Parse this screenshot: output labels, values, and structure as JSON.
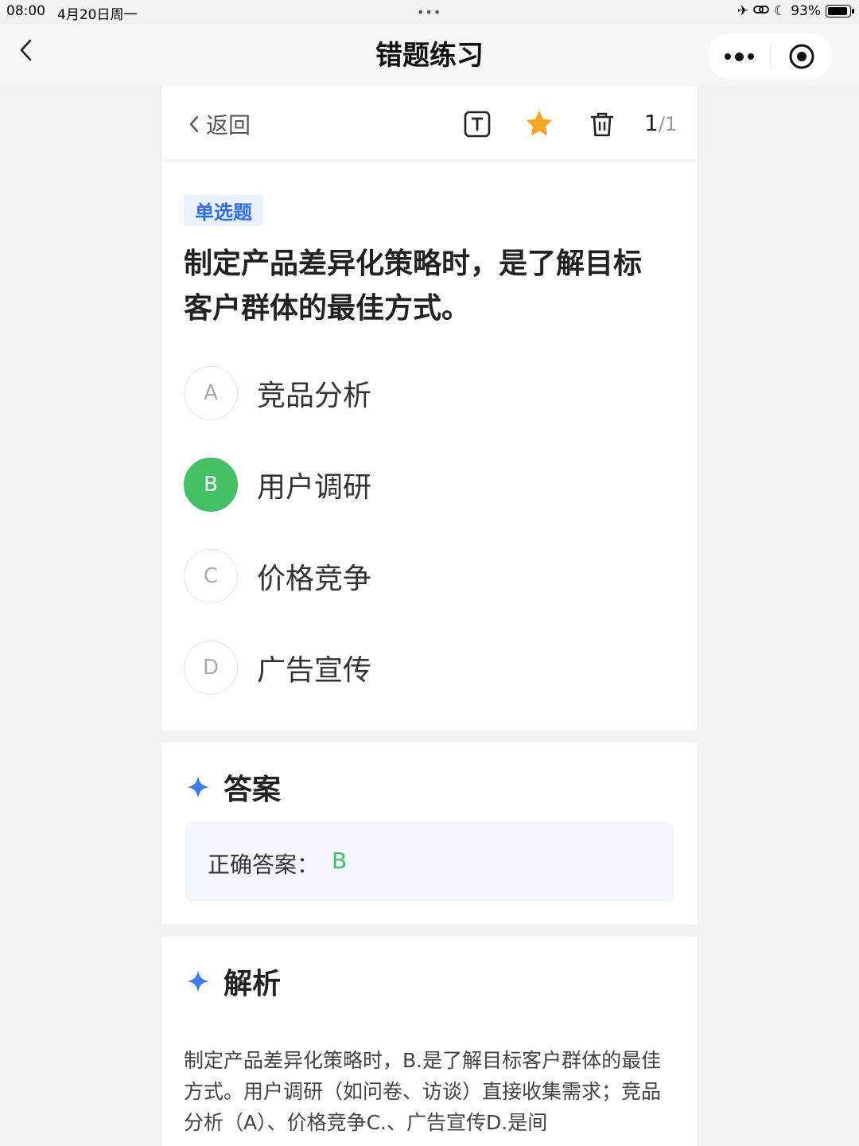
{
  "status_bar": {
    "time": "08:00",
    "date": "4月20日周一",
    "battery": "93%",
    "battery_level": 0.93
  },
  "nav": {
    "title": "错题练习"
  },
  "toolbar": {
    "back_label": "返回",
    "current": "1",
    "separator": "/",
    "total": "1",
    "icons": [
      "font-icon",
      "star-icon",
      "trash-icon"
    ],
    "star_color": "#f5a623"
  },
  "question": {
    "type_tag": "单选题",
    "text": "制定产品差异化策略时，是了解目标客户群体的最佳方式。",
    "options": [
      {
        "key": "A",
        "label": "竞品分析"
      },
      {
        "key": "B",
        "label": "用户调研",
        "correct": true
      },
      {
        "key": "C",
        "label": "价格竞争"
      },
      {
        "key": "D",
        "label": "广告宣传"
      }
    ]
  },
  "answer": {
    "title": "答案",
    "label": "正确答案：",
    "value": "B"
  },
  "analysis": {
    "title": "解析",
    "text": "制定产品差异化策略时，B.是了解目标客户群体的最佳方式。用户调研（如问卷、访谈）直接收集需求；竞品分析（A）、价格竞争C.、广告宣传D.是间"
  },
  "colors": {
    "correct": "#43c064",
    "accent_blue": "#2f6cf0"
  }
}
